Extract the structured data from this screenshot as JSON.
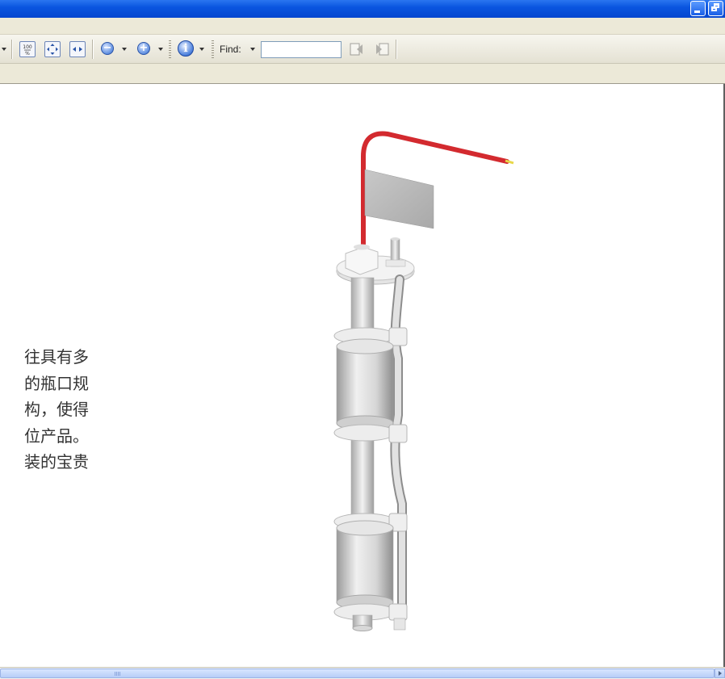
{
  "toolbar": {
    "find_label": "Find:",
    "find_value": ""
  },
  "document": {
    "text_lines": [
      "往具有多",
      "的瓶口规",
      "构，使得",
      "位产品。",
      "装的宝贵"
    ]
  },
  "colors": {
    "titlebar": "#0a55e0",
    "wire": "#d32a2f",
    "wire_tip": "#e8d84a"
  }
}
